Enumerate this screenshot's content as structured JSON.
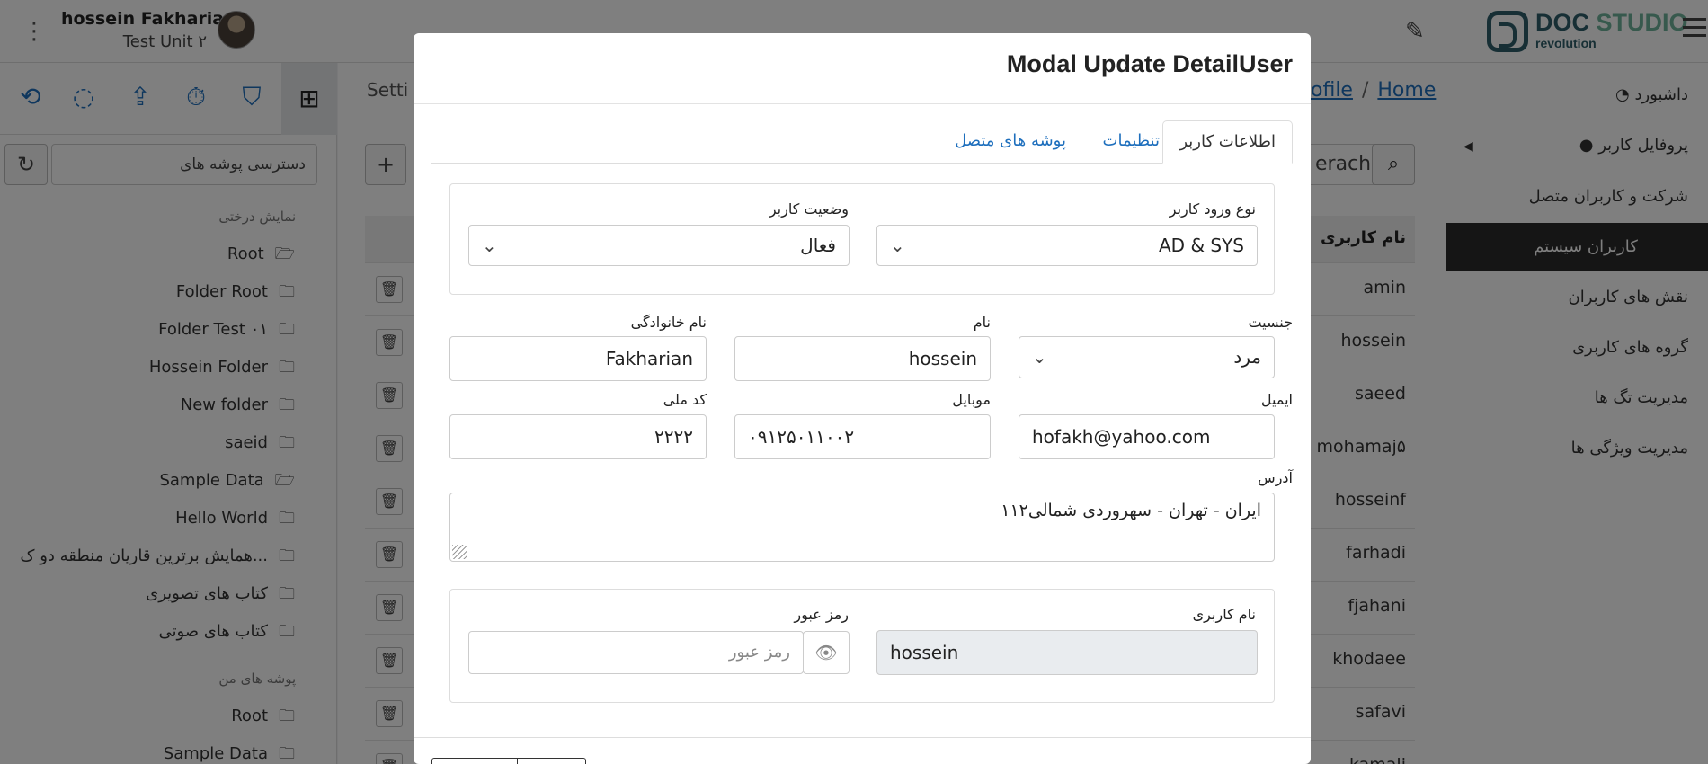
{
  "header": {
    "user_name": "hossein Fakharian",
    "user_unit": "Test Unit ۲",
    "logo_doc": "DOC",
    "logo_studio": "STUDIO",
    "logo_sub": "revolution"
  },
  "left_panel": {
    "toolbar_icons": [
      "history-icon",
      "task-done-icon",
      "share-icon",
      "timer-icon",
      "bookmark-icon",
      "folder-tree-icon"
    ],
    "search_placeholder": "دسترسی پوشه های",
    "tree_label": "نمایش درختی",
    "tree": [
      "Root",
      "Folder Root",
      "Folder Test ۰۱",
      "Hossein Folder",
      "New folder",
      "saeid",
      "Sample Data",
      "Hello World",
      "همایش برترین قاریان منطقه دو ک...",
      "کتاب های تصویری",
      "کتاب های صوتی"
    ],
    "my_folders_label": "پوشه های من",
    "my_folders": [
      "Root",
      "Sample Data"
    ]
  },
  "middle": {
    "tab_label": "Setti",
    "breadcrumb_profile": "ofile",
    "breadcrumb_sep": "/",
    "breadcrumb_home": "Home",
    "search_value": "erach",
    "column_username": "نام کاربری",
    "rows": [
      "amin",
      "hossein",
      "saeed",
      "mohamaj۵",
      "hosseinf",
      "farhadi",
      "fjahani",
      "khodaee",
      "safavi",
      "kamali"
    ]
  },
  "nav": {
    "items": [
      "داشبورد",
      "پروفایل کاربر",
      "شرکت و کاربران متصل",
      "کاربران سیستم",
      "نقش های کاربران",
      "گروه های کاربری",
      "مدیریت تگ ها",
      "مدیریت ویژگی ها"
    ],
    "active_index": 3
  },
  "modal": {
    "title": "Modal Update DetailUser",
    "tabs": [
      "اطلاعات کاربر",
      "تنظیمات",
      "پوشه های متصل"
    ],
    "active_tab": 0,
    "login_type_label": "نوع ورود کاربر",
    "login_type_value": "AD & SYS",
    "user_status_label": "وضعیت کاربر",
    "user_status_value": "فعال",
    "gender_label": "جنسیت",
    "gender_value": "مرد",
    "first_name_label": "نام",
    "first_name_value": "hossein",
    "last_name_label": "نام خانوادگی",
    "last_name_value": "Fakharian",
    "email_label": "ایمیل",
    "email_value": "hofakh@yahoo.com",
    "mobile_label": "موبایل",
    "mobile_value": "۰۹۱۲۵۰۱۱۰۰۲",
    "national_code_label": "کد ملی",
    "national_code_value": "۲۲۲۲",
    "address_label": "آدرس",
    "address_value": "ایران - تهران - سهروردی شمالی۱۱۲",
    "username_label": "نام کاربری",
    "username_value": "hossein",
    "password_label": "رمز عبور",
    "password_placeholder": "رمز عبور"
  }
}
